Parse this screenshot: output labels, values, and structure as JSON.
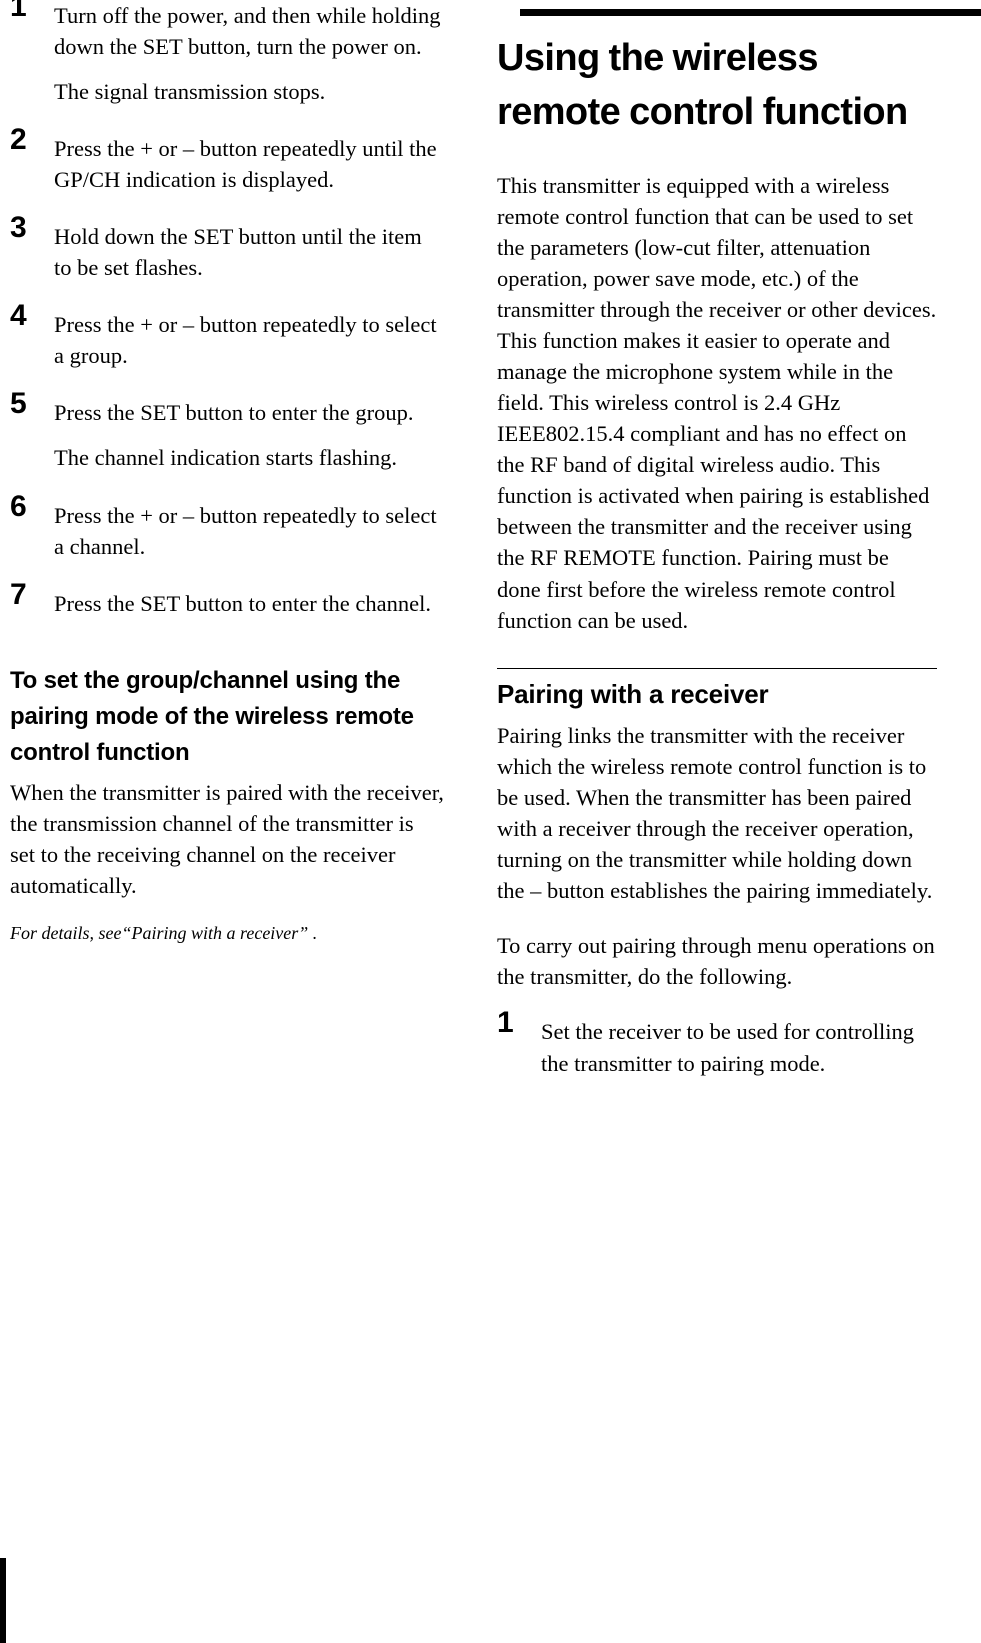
{
  "left_column": {
    "steps": [
      {
        "number": "1",
        "text": "Turn off the power, and then while holding down the SET button, turn the power on.",
        "result": "The signal transmission stops."
      },
      {
        "number": "2",
        "text": "Press the + or – button repeatedly until the GP/CH indication is displayed.",
        "result": ""
      },
      {
        "number": "3",
        "text": "Hold down the SET button until the item to be set flashes.",
        "result": ""
      },
      {
        "number": "4",
        "text": "Press the + or – button repeatedly to select a group.",
        "result": ""
      },
      {
        "number": "5",
        "text": "Press the SET button to enter the group.",
        "result": "The channel indication starts flashing."
      },
      {
        "number": "6",
        "text": "Press the + or – button repeatedly to select a channel.",
        "result": ""
      },
      {
        "number": "7",
        "text": "Press the SET button to enter the channel.",
        "result": ""
      }
    ],
    "sub_heading": "To set the group/channel using the pairing mode of the wireless remote control function",
    "paragraph": "When the transmitter is paired with the receiver, the transmission channel of the transmitter is set to the receiving channel on the receiver automatically.",
    "note": "For details, see“Pairing with a receiver” ."
  },
  "right_column": {
    "chapter_title": "Using the wireless remote control function",
    "intro_paragraph": "This transmitter is equipped with a wireless remote control function that can be used to set the parameters (low-cut filter, attenuation operation, power save mode, etc.) of the transmitter through the receiver or other devices. This function makes it easier to operate and manage the microphone system while in the field. This wireless control is 2.4 GHz IEEE802.15.4 compliant and has no effect on the RF band of digital wireless audio. This function is activated when pairing is established between the transmitter and the receiver using the RF REMOTE function. Pairing must be done first before the wireless remote control function can be used.",
    "section_heading": "Pairing with a receiver",
    "paragraph_1": "Pairing links the transmitter with the receiver which the wireless remote control function is to be used. When the transmitter has been paired with a receiver through the receiver operation, turning on the transmitter while holding down the – button establishes the pairing immediately.",
    "paragraph_2": "To carry out pairing through menu operations on the transmitter, do the following.",
    "steps": [
      {
        "number": "1",
        "text": "Set the receiver to be used for controlling the transmitter to pairing mode."
      }
    ]
  }
}
